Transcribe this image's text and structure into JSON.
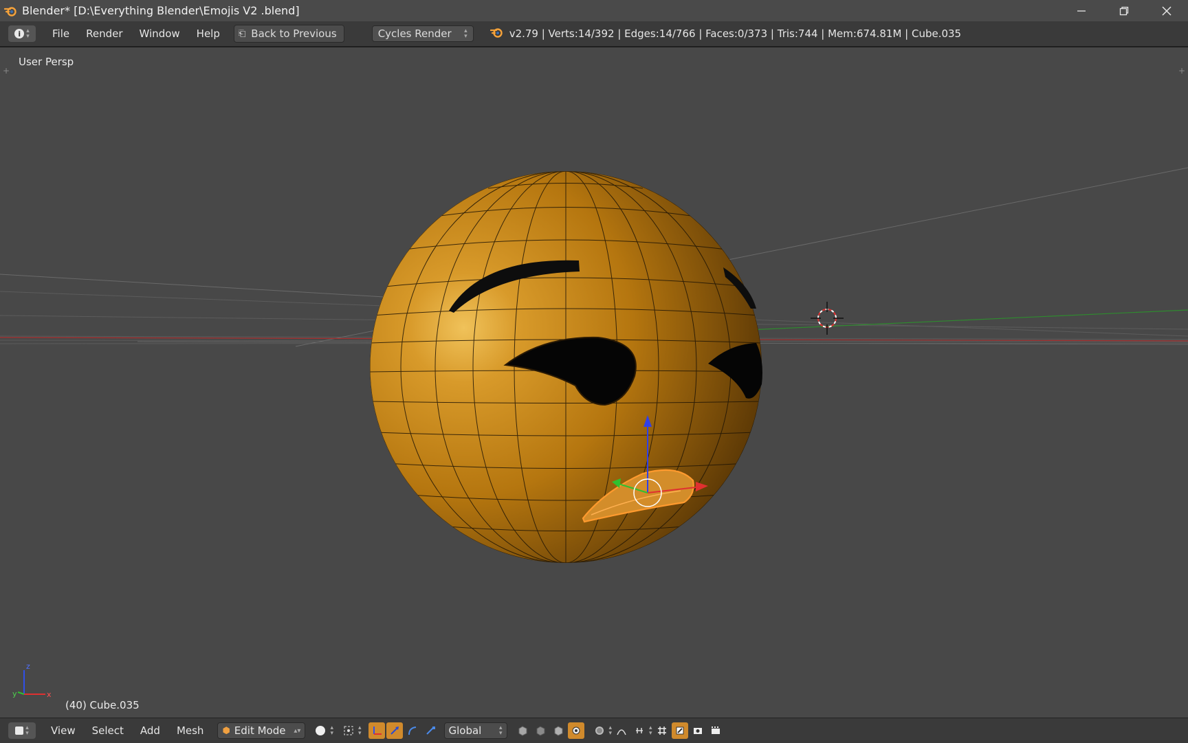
{
  "window": {
    "title": "Blender* [D:\\Everything Blender\\Emojis V2 .blend]",
    "controls": [
      "minimize-icon",
      "restore-icon",
      "close-icon"
    ]
  },
  "info_header": {
    "menus": [
      "File",
      "Render",
      "Window",
      "Help"
    ],
    "back_button": "Back to Previous",
    "render_engine": "Cycles Render",
    "stats": "v2.79 | Verts:14/392 | Edges:14/766 | Faces:0/373 | Tris:744 | Mem:674.81M | Cube.035"
  },
  "viewport": {
    "view_label": "User Persp",
    "object_label": "(40) Cube.035",
    "axis_labels": {
      "x": "x",
      "y": "y",
      "z": "z"
    },
    "colors": {
      "background": "#484848",
      "sphere": "#c98a1e",
      "sphere_dark": "#5e3a06",
      "wire": "#1a1206",
      "axis_x": "#d03030",
      "axis_y": "#2fb52f",
      "axis_z": "#2f4fe0",
      "selection": "#ff9a2e"
    }
  },
  "bottom_header": {
    "menus": [
      "View",
      "Select",
      "Add",
      "Mesh"
    ],
    "mode": "Edit Mode",
    "orientation": "Global"
  }
}
